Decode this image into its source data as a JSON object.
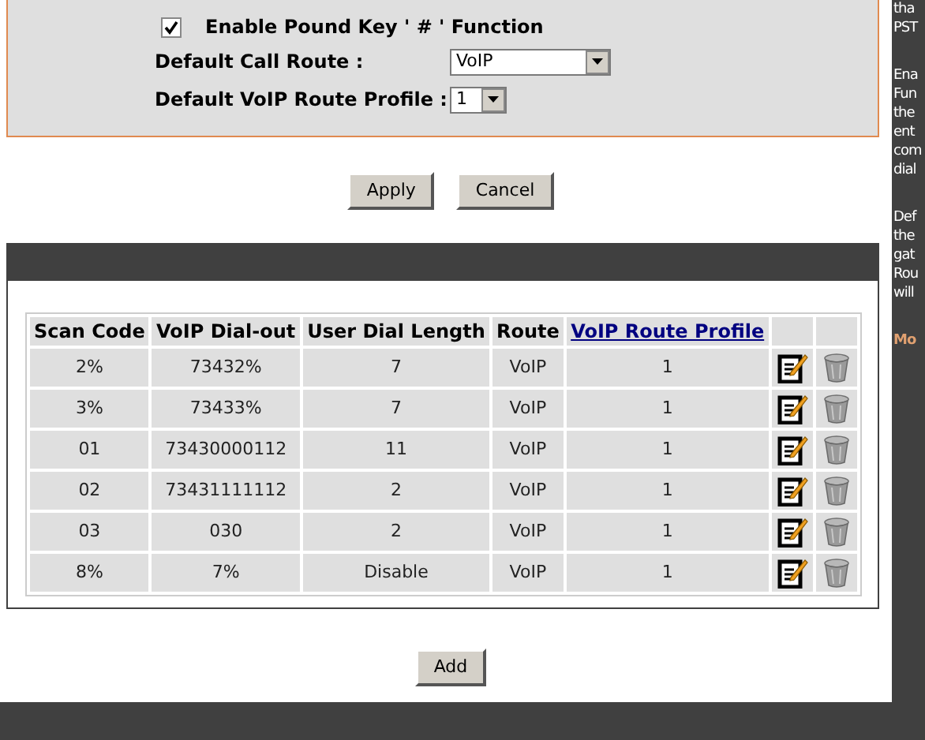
{
  "settings": {
    "pound_key": {
      "label": "Enable Pound Key ' # ' Function",
      "checked": true
    },
    "fields": [
      {
        "label": "Default Call Route :",
        "value": "VoIP",
        "kind": "wide"
      },
      {
        "label": "Default VoIP Route Profile :",
        "value": "1",
        "kind": "narrow"
      }
    ]
  },
  "buttons": [
    "Apply",
    "Cancel"
  ],
  "table": {
    "columns": [
      {
        "label": "Scan Code",
        "kind": "text"
      },
      {
        "label": "VoIP Dial-out",
        "kind": "text"
      },
      {
        "label": "User Dial Length",
        "kind": "text"
      },
      {
        "label": "Route",
        "kind": "text"
      },
      {
        "label": "VoIP Route Profile",
        "kind": "link"
      }
    ],
    "rows": [
      [
        "2%",
        "73432%",
        "7",
        "VoIP",
        "1"
      ],
      [
        "3%",
        "73433%",
        "7",
        "VoIP",
        "1"
      ],
      [
        "01",
        "73430000112",
        "11",
        "VoIP",
        "1"
      ],
      [
        "02",
        "73431111112",
        "2",
        "VoIP",
        "1"
      ],
      [
        "03",
        "030",
        "2",
        "VoIP",
        "1"
      ],
      [
        "8%",
        "7%",
        "Disable",
        "VoIP",
        "1"
      ]
    ]
  },
  "add_button": "Add",
  "help_sidebar": {
    "paragraphs": [
      [
        "tha",
        "PST"
      ],
      [
        "Ena",
        "Fun",
        "the",
        "ent",
        "com",
        "dial"
      ],
      [
        "Def",
        "the",
        "gat",
        "Rou",
        "will"
      ]
    ],
    "more_link": "Mo"
  }
}
